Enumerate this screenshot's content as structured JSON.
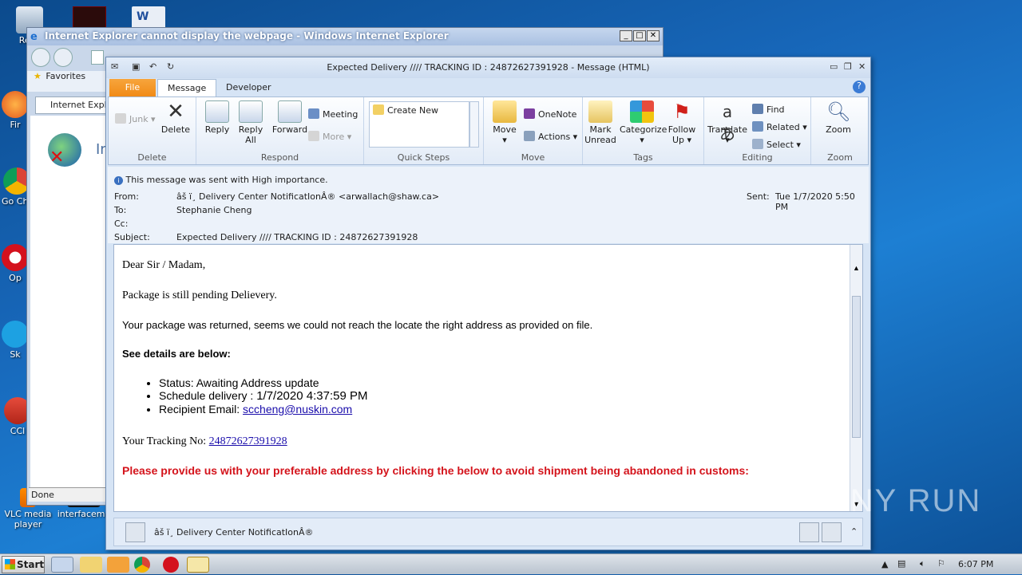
{
  "desktop": {
    "icons": [
      {
        "label": "Recy"
      },
      {
        "label": "Fir"
      },
      {
        "label": "Go Chr"
      },
      {
        "label": "Op"
      },
      {
        "label": "Sk"
      },
      {
        "label": "CCl"
      },
      {
        "label": "VLC media player"
      },
      {
        "label": "interfaceme"
      }
    ]
  },
  "ie": {
    "title": "Internet Explorer cannot display the webpage - Windows Internet Explorer",
    "favorites": "Favorites",
    "tab": "Internet Explor",
    "heading": "In",
    "status": "Done"
  },
  "message": {
    "title": "Expected Delivery //// TRACKING ID : 24872627391928  -  Message (HTML)",
    "tabs": {
      "file": "File",
      "message": "Message",
      "developer": "Developer"
    },
    "ribbon": {
      "delete_group": {
        "label": "Delete",
        "junk": "Junk",
        "delete": "Delete"
      },
      "respond_group": {
        "label": "Respond",
        "reply": "Reply",
        "reply_all": "Reply All",
        "forward": "Forward",
        "meeting": "Meeting",
        "more": "More"
      },
      "quicksteps_group": {
        "label": "Quick Steps",
        "create_new": "Create New"
      },
      "move_group": {
        "label": "Move",
        "move": "Move",
        "onenote": "OneNote",
        "actions": "Actions"
      },
      "tags_group": {
        "label": "Tags",
        "mark_unread": "Mark Unread",
        "categorize": "Categorize",
        "follow_up": "Follow Up"
      },
      "editing_group": {
        "label": "Editing",
        "translate": "Translate",
        "find": "Find",
        "related": "Related",
        "select": "Select"
      },
      "zoom_group": {
        "label": "Zoom",
        "zoom": "Zoom"
      }
    },
    "header": {
      "importance": "This message was sent with High importance.",
      "from_label": "From:",
      "from_value": "âš ï¸ Delivery Center NotificatIonÂ® <arwallach@shaw.ca>",
      "to_label": "To:",
      "to_value": "Stephanie Cheng",
      "cc_label": "Cc:",
      "subject_label": "Subject:",
      "subject_value": "Expected Delivery //// TRACKING ID : 24872627391928",
      "sent_label": "Sent:",
      "sent_value": "Tue 1/7/2020 5:50 PM"
    },
    "body": {
      "greeting": "Dear Sir / Madam,",
      "line1": "Package is still pending Delievery.",
      "line2": "Your package was returned, seems we could not reach the locate the right address as provided on file.",
      "details_heading": "See details are below:",
      "status_item": "Status: Awaiting Address update",
      "schedule_label": "Schedule delivery :",
      "schedule_value": "1/7/2020 4:37:59 PM",
      "email_label": "Recipient Email:",
      "email_value": "sccheng@nuskin.com",
      "tracking_label": "Your Tracking No:",
      "tracking_value": "24872627391928",
      "warning": "Please provide us with your preferable address by clicking the below to avoid shipment being abandoned in customs:"
    },
    "people_pane": {
      "sender": "âš ï¸ Delivery Center NotificatIonÂ®"
    }
  },
  "taskbar": {
    "start": "Start",
    "time": "6:07 PM"
  },
  "watermark": "ANY RUN"
}
